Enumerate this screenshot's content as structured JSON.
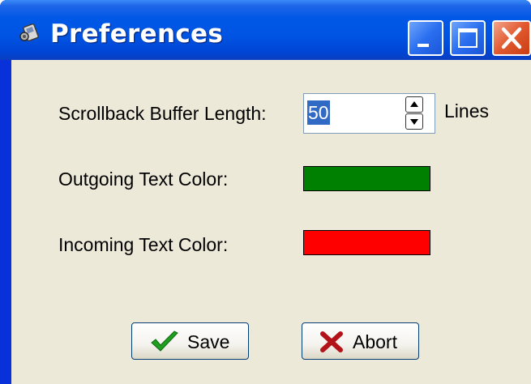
{
  "window": {
    "title": "Preferences",
    "title_icon": "app-icon",
    "controls": [
      "minimize",
      "maximize",
      "close"
    ]
  },
  "form": {
    "scrollback": {
      "label": "Scrollback Buffer Length:",
      "value": "50",
      "unit": "Lines"
    },
    "outgoing": {
      "label": "Outgoing Text Color:",
      "color": "#008000"
    },
    "incoming": {
      "label": "Incoming Text Color:",
      "color": "#ff0000"
    }
  },
  "buttons": {
    "save": {
      "label": "Save",
      "icon": "checkmark-icon",
      "icon_color": "#1f9e1f"
    },
    "abort": {
      "label": "Abort",
      "icon": "x-mark-icon",
      "icon_color": "#b3141a"
    }
  },
  "colors": {
    "titlebar": "#0054e3",
    "dialog_background": "#ece9d8",
    "selection": "#316ac5"
  }
}
